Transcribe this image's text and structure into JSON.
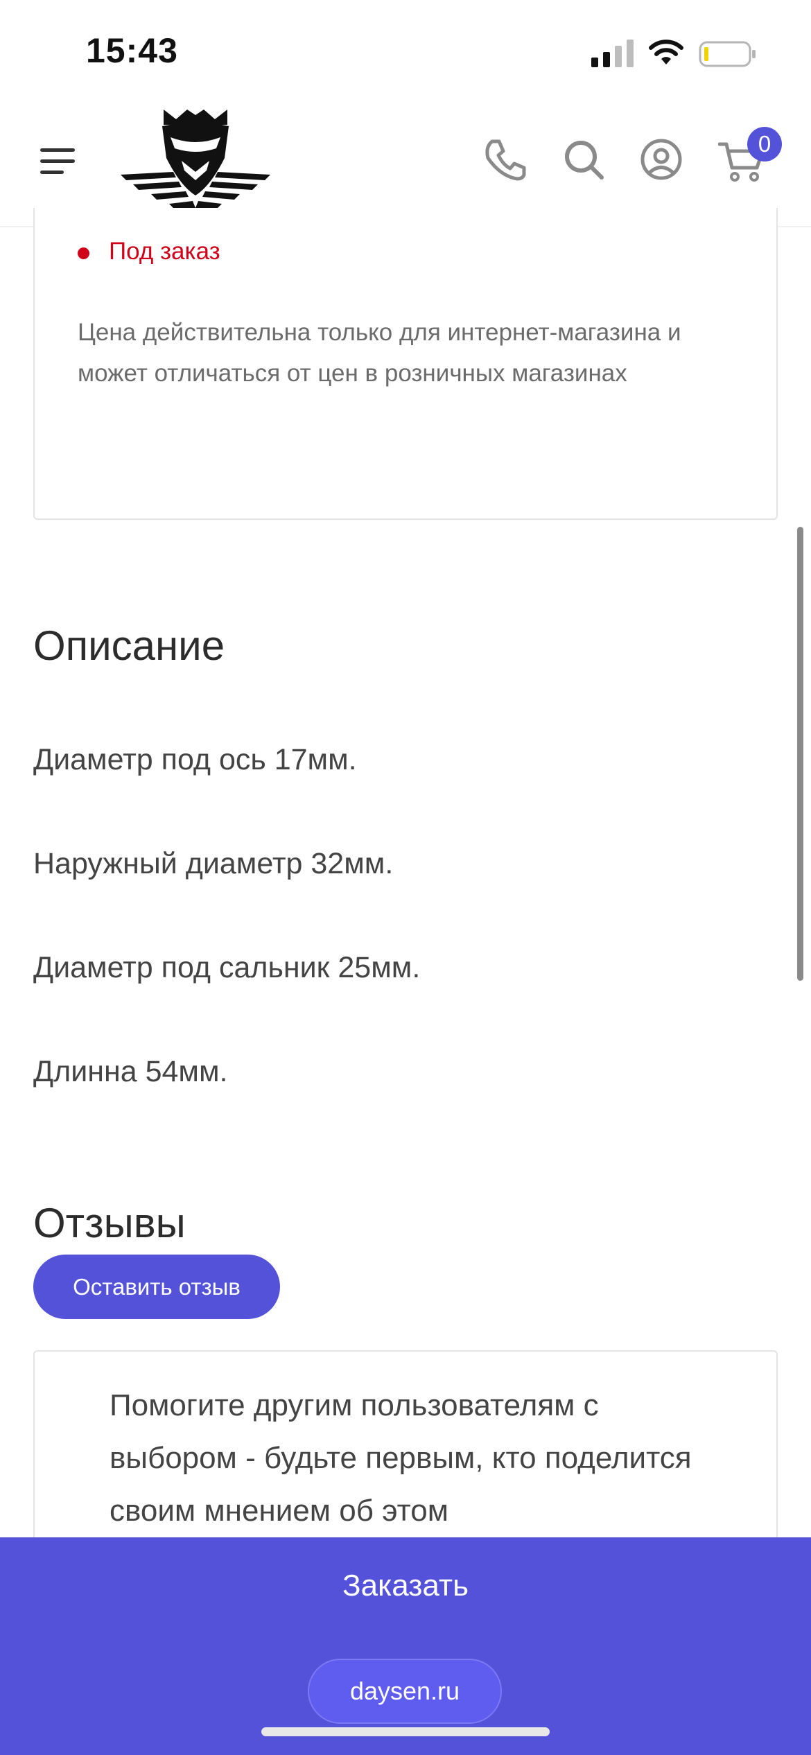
{
  "status_bar": {
    "time": "15:43"
  },
  "header": {
    "logo_name": "helmet-logo",
    "cart_count": "0",
    "icons": [
      "menu-icon",
      "phone-icon",
      "search-icon",
      "user-icon",
      "cart-icon"
    ]
  },
  "product": {
    "availability": "Под заказ",
    "price_note": "Цена действительна только для интернет-магазина и может отличаться от цен в розничных магазинах"
  },
  "description": {
    "title": "Описание",
    "lines": [
      "Диаметр под ось 17мм.",
      "Наружный диаметр 32мм.",
      "Диаметр под сальник 25мм.",
      "Длинна 54мм."
    ]
  },
  "reviews": {
    "title": "Отзывы",
    "button_label": "Оставить отзыв",
    "empty_hint": "Помогите другим пользователям с выбором - будьте первым, кто поделится своим мнением об этом"
  },
  "order_bar": {
    "order_label": "Заказать",
    "site_url": "daysen.ru"
  },
  "colors": {
    "accent": "#5352d8",
    "stock_red": "#d0021b"
  }
}
